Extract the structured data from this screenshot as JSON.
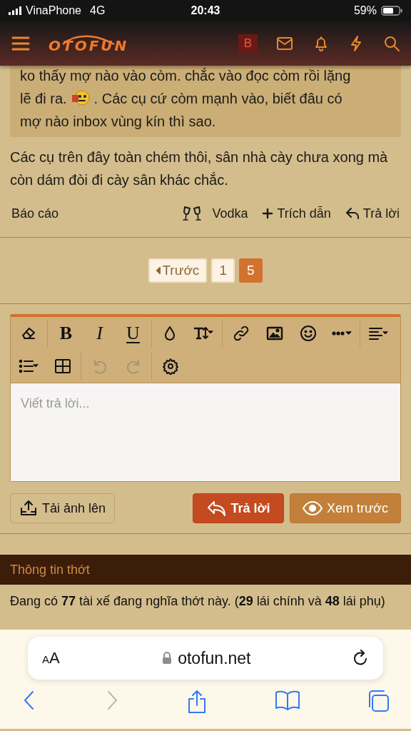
{
  "status_bar": {
    "carrier": "VinaPhone",
    "network": "4G",
    "time": "20:43",
    "battery": "59%"
  },
  "header": {
    "logo": "OTOFUN",
    "avatar": "B"
  },
  "quote": {
    "line_1": "ko thấy mợ nào vào còm. chắc vào đọc còm rồi lặng",
    "line_2_before": "lẽ đi ra.",
    "line_2_after": ". Các cụ cứ còm mạnh vào, biết đâu có",
    "line_3": "mợ nào inbox vùng kín thì sao."
  },
  "post": {
    "text": "Các cụ trên đây toàn chém thôi, sân nhà cày chưa xong mà còn dám đòi đi cày sân khác chắc.",
    "report": "Báo cáo",
    "actions": [
      {
        "kind": "vodka",
        "label": "Vodka"
      },
      {
        "kind": "quote",
        "label": "Trích dẫn"
      },
      {
        "kind": "reply",
        "label": "Trả lời"
      }
    ]
  },
  "pager": [
    {
      "kind": "prev",
      "label": "Trước",
      "selected": false
    },
    {
      "kind": "page",
      "label": "1",
      "selected": false
    },
    {
      "kind": "page",
      "label": "5",
      "selected": true
    }
  ],
  "toolbar": {
    "rows": [
      [
        [
          {
            "kind": "eraser",
            "disabled": false
          }
        ],
        [
          {
            "kind": "bold",
            "label": "B",
            "disabled": false
          },
          {
            "kind": "italic",
            "label": "I",
            "disabled": false
          },
          {
            "kind": "underline",
            "label": "U",
            "disabled": false
          }
        ],
        [
          {
            "kind": "color",
            "disabled": false
          },
          {
            "kind": "size",
            "disabled": false
          }
        ],
        [
          {
            "kind": "link",
            "disabled": false
          },
          {
            "kind": "image",
            "disabled": false
          },
          {
            "kind": "smiley",
            "disabled": false
          },
          {
            "kind": "more",
            "disabled": false
          }
        ],
        [
          {
            "kind": "align",
            "disabled": false
          }
        ]
      ],
      [
        [
          {
            "kind": "list",
            "disabled": false
          },
          {
            "kind": "table",
            "disabled": false
          }
        ],
        [
          {
            "kind": "undo",
            "disabled": true
          },
          {
            "kind": "redo",
            "disabled": true
          }
        ],
        [
          {
            "kind": "settings",
            "disabled": false
          }
        ]
      ]
    ]
  },
  "editor": {
    "placeholder": "Viết trả lời..."
  },
  "buttons": {
    "upload": "Tải ảnh lên",
    "reply": "Trả lời",
    "preview": "Xem trước"
  },
  "thread_info": {
    "title": "Thông tin thớt",
    "text": "Đang có **77** tài xế đang nghĩa thớt này. (**29** lái chính và **48** lái phụ)"
  },
  "browser": {
    "text_size": "AA",
    "url": "otofun.net",
    "back_disabled": false,
    "forward_disabled": true
  }
}
